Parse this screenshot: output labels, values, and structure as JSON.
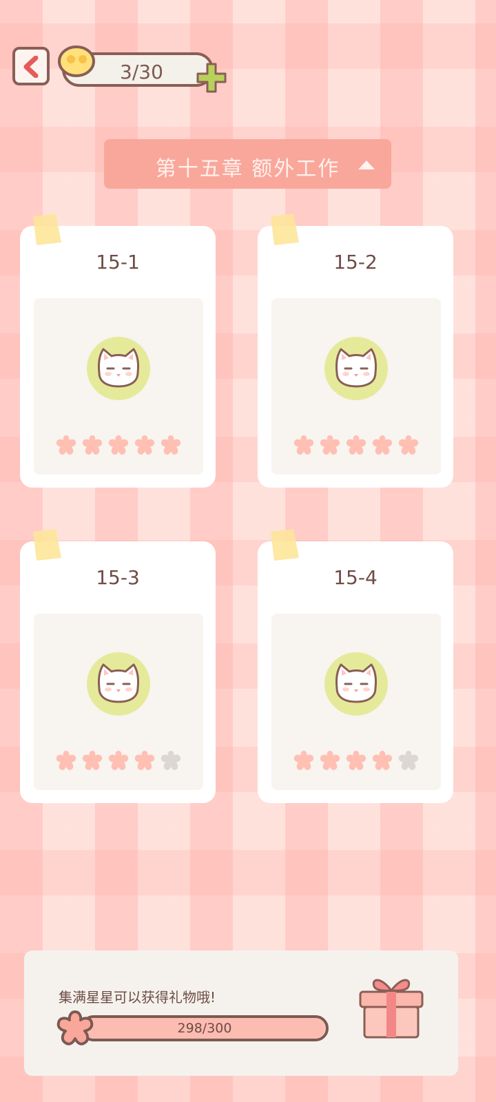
{
  "header": {
    "coins": "3/30"
  },
  "chapter": {
    "title": "第十五章  额外工作"
  },
  "levels": [
    {
      "label": "15-1",
      "stars": 5,
      "max_stars": 5
    },
    {
      "label": "15-2",
      "stars": 5,
      "max_stars": 5
    },
    {
      "label": "15-3",
      "stars": 4,
      "max_stars": 5
    },
    {
      "label": "15-4",
      "stars": 4,
      "max_stars": 5
    }
  ],
  "gift": {
    "message": "集满星星可以获得礼物哦!",
    "progress_text": "298/300",
    "progress_value": 298,
    "progress_max": 300
  },
  "colors": {
    "star_filled": "#ffbfb3",
    "star_empty": "#dcd7d3",
    "accent": "#f9a79b",
    "outline": "#7b5a52"
  }
}
